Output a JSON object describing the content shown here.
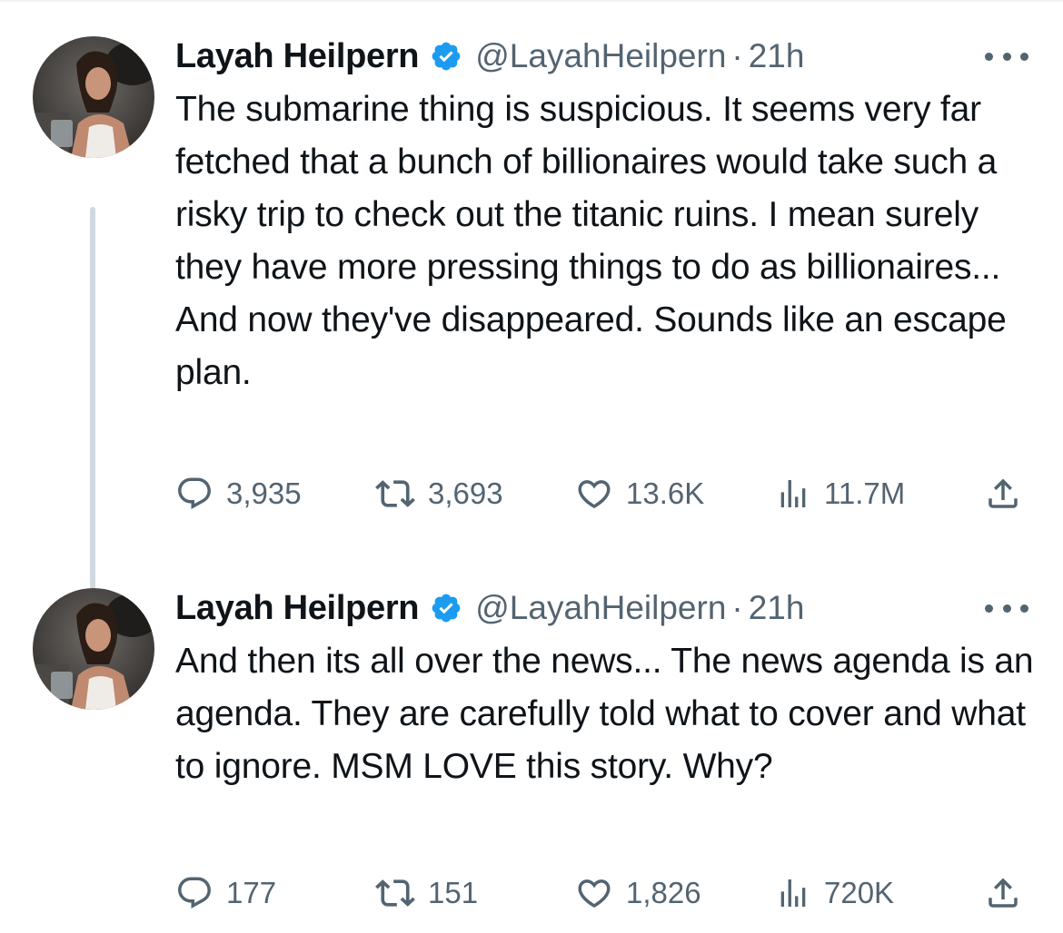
{
  "tweets": [
    {
      "author": {
        "name": "Layah Heilpern",
        "handle": "@LayahHeilpern",
        "verified": true,
        "avatar_icon": "profile-photo"
      },
      "separator": "·",
      "time": "21h",
      "text": "The submarine thing is suspicious. It seems very far fetched that a bunch of billionaires would take such a risky trip to check out the titanic ruins. I mean surely they have more pressing things to do as billionaires... And now they've disappeared. Sounds like an escape plan.",
      "stats": {
        "replies": "3,935",
        "retweets": "3,693",
        "likes": "13.6K",
        "views": "11.7M"
      }
    },
    {
      "author": {
        "name": "Layah Heilpern",
        "handle": "@LayahHeilpern",
        "verified": true,
        "avatar_icon": "profile-photo"
      },
      "separator": "·",
      "time": "21h",
      "text": "And then its all over the news... The news agenda is an agenda. They are carefully told what to cover and what to ignore. MSM LOVE this story. Why?",
      "stats": {
        "replies": "177",
        "retweets": "151",
        "likes": "1,826",
        "views": "720K"
      }
    }
  ],
  "colors": {
    "text_primary": "#0f1419",
    "text_secondary": "#536471",
    "verified_blue": "#1d9bf0",
    "thread_line": "#cfd9de"
  },
  "icons": {
    "reply": "speech-bubble-icon",
    "retweet": "retweet-arrows-icon",
    "like": "heart-icon",
    "views": "bar-chart-icon",
    "share": "share-upload-icon",
    "more": "three-dots-icon",
    "verified": "verified-badge-icon"
  }
}
